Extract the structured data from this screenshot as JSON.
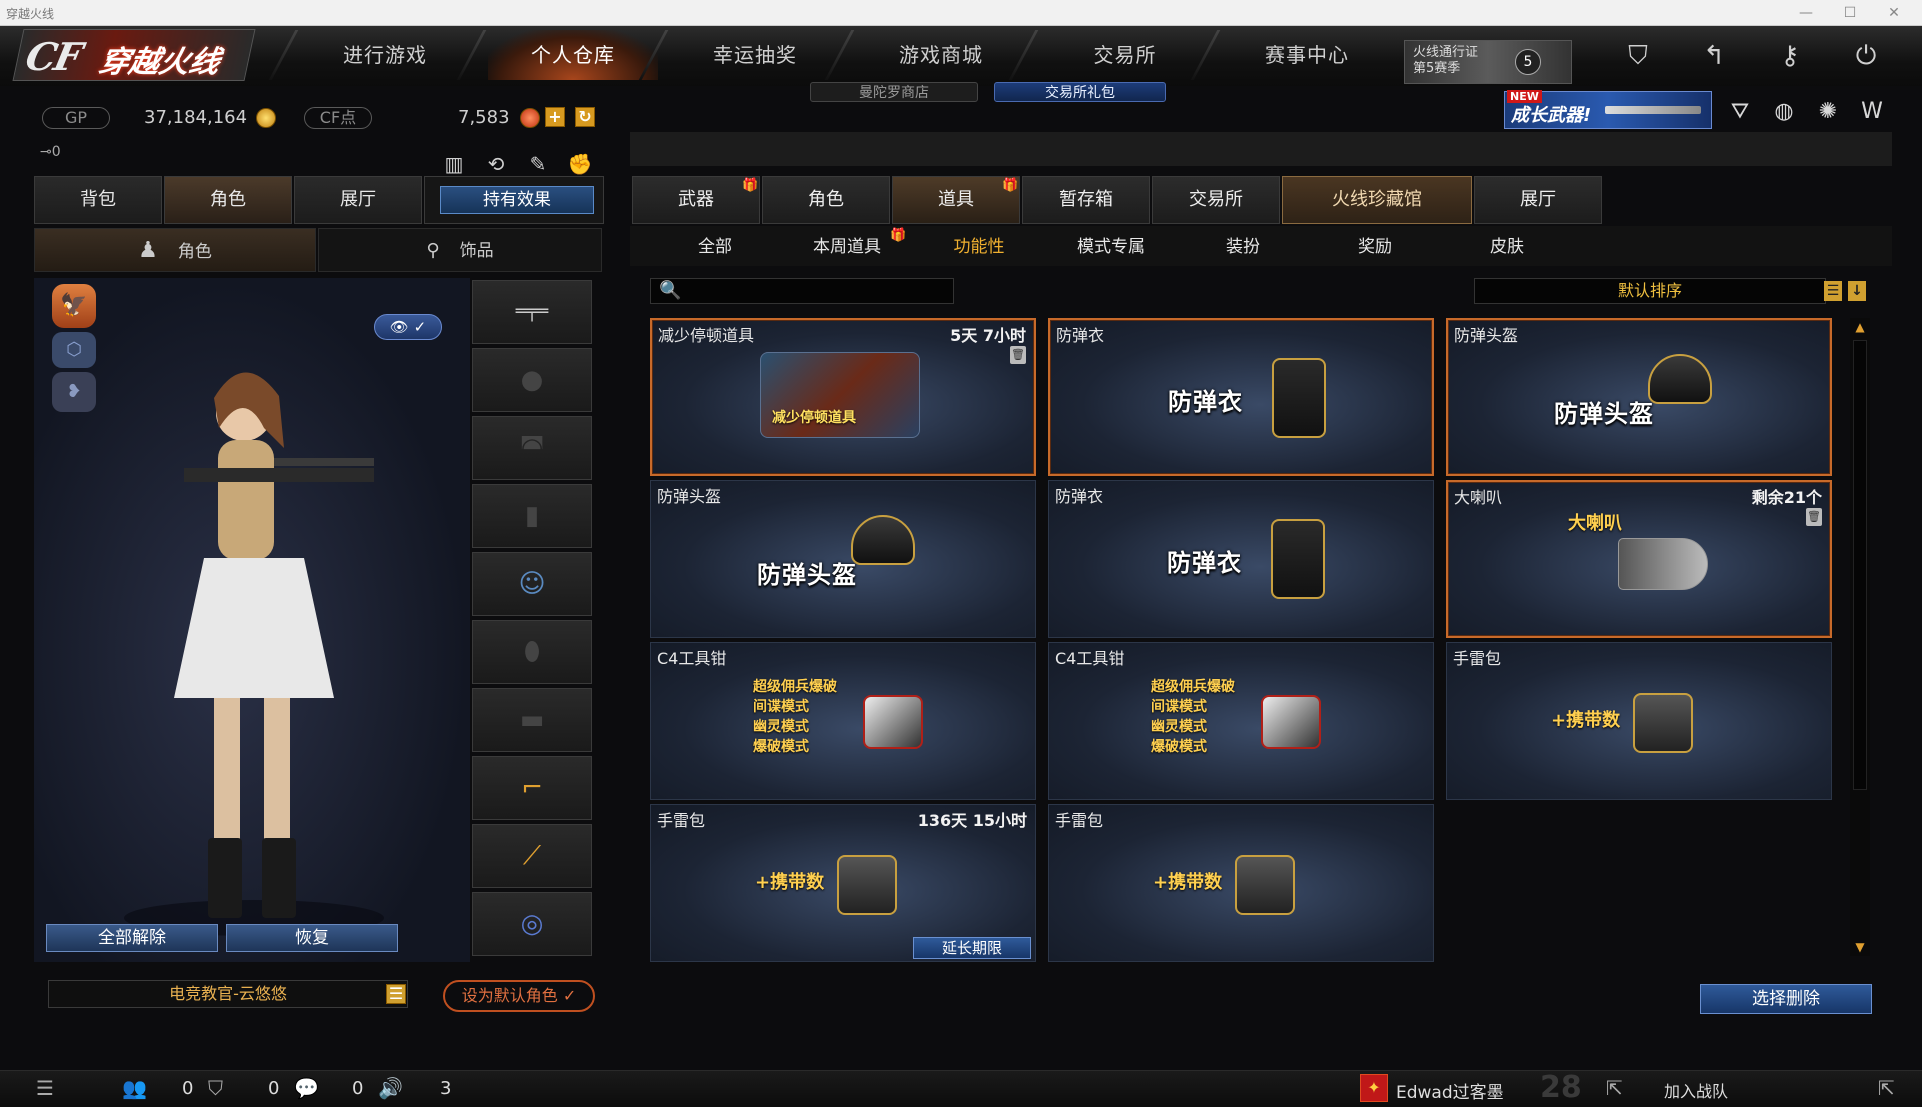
{
  "window": {
    "title": "穿越火线"
  },
  "nav": {
    "logo_en": "CF",
    "logo_cn": "穿越火线",
    "tabs": [
      "进行游戏",
      "个人仓库",
      "幸运抽奖",
      "游戏商城",
      "交易所",
      "赛事中心"
    ],
    "active_tab": "个人仓库",
    "subtabs": [
      "曼陀罗商店",
      "交易所礼包"
    ],
    "pass_line1": "火线通行证",
    "pass_line2": "第5赛季",
    "pass_level": "5",
    "banner_new": "NEW",
    "banner_text": "成长武器!"
  },
  "currency": {
    "gp_label": "GP",
    "gp_value": "37,184,164",
    "cf_label": "CF点",
    "cf_value": "7,583",
    "key_count": "0"
  },
  "left_tabs": [
    "背包",
    "角色",
    "展厅"
  ],
  "left_active": "角色",
  "effects_button": "持有效果",
  "sub_left_tabs": [
    "角色",
    "饰品"
  ],
  "character": {
    "unequip_all": "全部解除",
    "restore": "恢复",
    "role_name": "电竞教官-云悠悠",
    "set_default": "设为默认角色"
  },
  "right_tabs": [
    "武器",
    "角色",
    "道具",
    "暂存箱",
    "交易所",
    "火线珍藏馆",
    "展厅"
  ],
  "right_active": "道具",
  "filters": [
    "全部",
    "本周道具",
    "功能性",
    "模式专属",
    "装扮",
    "奖励",
    "皮肤"
  ],
  "filter_active": "功能性",
  "search": {
    "placeholder": ""
  },
  "sort": {
    "label": "默认排序"
  },
  "items": [
    {
      "name": "减少停顿道具",
      "duration": "5天 7小时",
      "art_label": "减少停顿道具",
      "type": "slowdown",
      "locked": true,
      "selected": true
    },
    {
      "name": "防弹衣",
      "duration": "",
      "art_label": "防弹衣",
      "type": "vest",
      "locked": false,
      "selected": true
    },
    {
      "name": "防弹头盔",
      "duration": "",
      "art_label": "防弹头盔",
      "type": "helmet",
      "locked": false,
      "selected": true
    },
    {
      "name": "防弹头盔",
      "duration": "",
      "art_label": "防弹头盔",
      "type": "helmet",
      "locked": false,
      "selected": false
    },
    {
      "name": "防弹衣",
      "duration": "",
      "art_label": "防弹衣",
      "type": "vest",
      "locked": false,
      "selected": false
    },
    {
      "name": "大喇叭",
      "duration": "剩余21个",
      "art_label": "大喇叭",
      "type": "horn",
      "locked": true,
      "selected": true
    },
    {
      "name": "C4工具钳",
      "duration": "",
      "art_lines": [
        "超级佣兵爆破",
        "间谍模式",
        "幽灵模式",
        "爆破模式"
      ],
      "type": "c4",
      "locked": false,
      "selected": false
    },
    {
      "name": "C4工具钳",
      "duration": "",
      "art_lines": [
        "超级佣兵爆破",
        "间谍模式",
        "幽灵模式",
        "爆破模式"
      ],
      "type": "c4",
      "locked": false,
      "selected": false
    },
    {
      "name": "手雷包",
      "duration": "",
      "art_label": "+携带数",
      "type": "grenade",
      "locked": false,
      "selected": false
    },
    {
      "name": "手雷包",
      "duration": "136天 15小时",
      "art_label": "+携带数",
      "type": "grenade",
      "locked": false,
      "selected": false,
      "extend": "延长期限"
    },
    {
      "name": "手雷包",
      "duration": "",
      "art_label": "+携带数",
      "type": "grenade",
      "locked": false,
      "selected": false
    }
  ],
  "select_delete": "选择删除",
  "status": {
    "count1": "0",
    "count2": "0",
    "count3": "0",
    "count4": "3",
    "clan_name": "Edwad过客墨",
    "clan_level": "28",
    "join_team": "加入战队"
  },
  "colors": {
    "accent_orange": "#c86a2a",
    "gold": "#f0b030",
    "blue_button": "#2f5a9a"
  }
}
